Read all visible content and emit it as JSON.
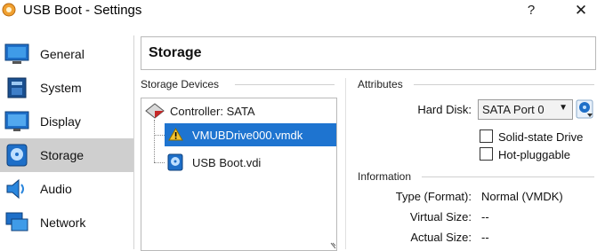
{
  "window": {
    "title": "USB Boot - Settings",
    "help_label": "?",
    "close_label": "✕"
  },
  "sidebar": {
    "items": [
      {
        "label": "General",
        "icon": "general-icon"
      },
      {
        "label": "System",
        "icon": "system-icon"
      },
      {
        "label": "Display",
        "icon": "display-icon"
      },
      {
        "label": "Storage",
        "icon": "storage-icon",
        "active": true
      },
      {
        "label": "Audio",
        "icon": "audio-icon"
      },
      {
        "label": "Network",
        "icon": "network-icon"
      }
    ]
  },
  "page": {
    "title": "Storage"
  },
  "storage_devices": {
    "label": "Storage Devices",
    "controller": "Controller: SATA",
    "items": [
      {
        "name": "VMUBDrive000.vmdk",
        "icon": "warning-icon",
        "selected": true
      },
      {
        "name": "USB Boot.vdi",
        "icon": "hard-disk-icon",
        "selected": false
      }
    ]
  },
  "attributes": {
    "label": "Attributes",
    "hard_disk_label": "Hard Disk:",
    "hard_disk_value": "SATA Port 0",
    "solid_state_label": "Solid-state Drive",
    "solid_state_checked": false,
    "hot_pluggable_label": "Hot-pluggable",
    "hot_pluggable_checked": false
  },
  "information": {
    "label": "Information",
    "type_label": "Type (Format):",
    "type_value": "Normal (VMDK)",
    "virtual_size_label": "Virtual Size:",
    "virtual_size_value": "--",
    "actual_size_label": "Actual Size:",
    "actual_size_value": "--"
  },
  "colors": {
    "selection": "#1e74d0",
    "active_sidebar": "#cfcfcf"
  }
}
